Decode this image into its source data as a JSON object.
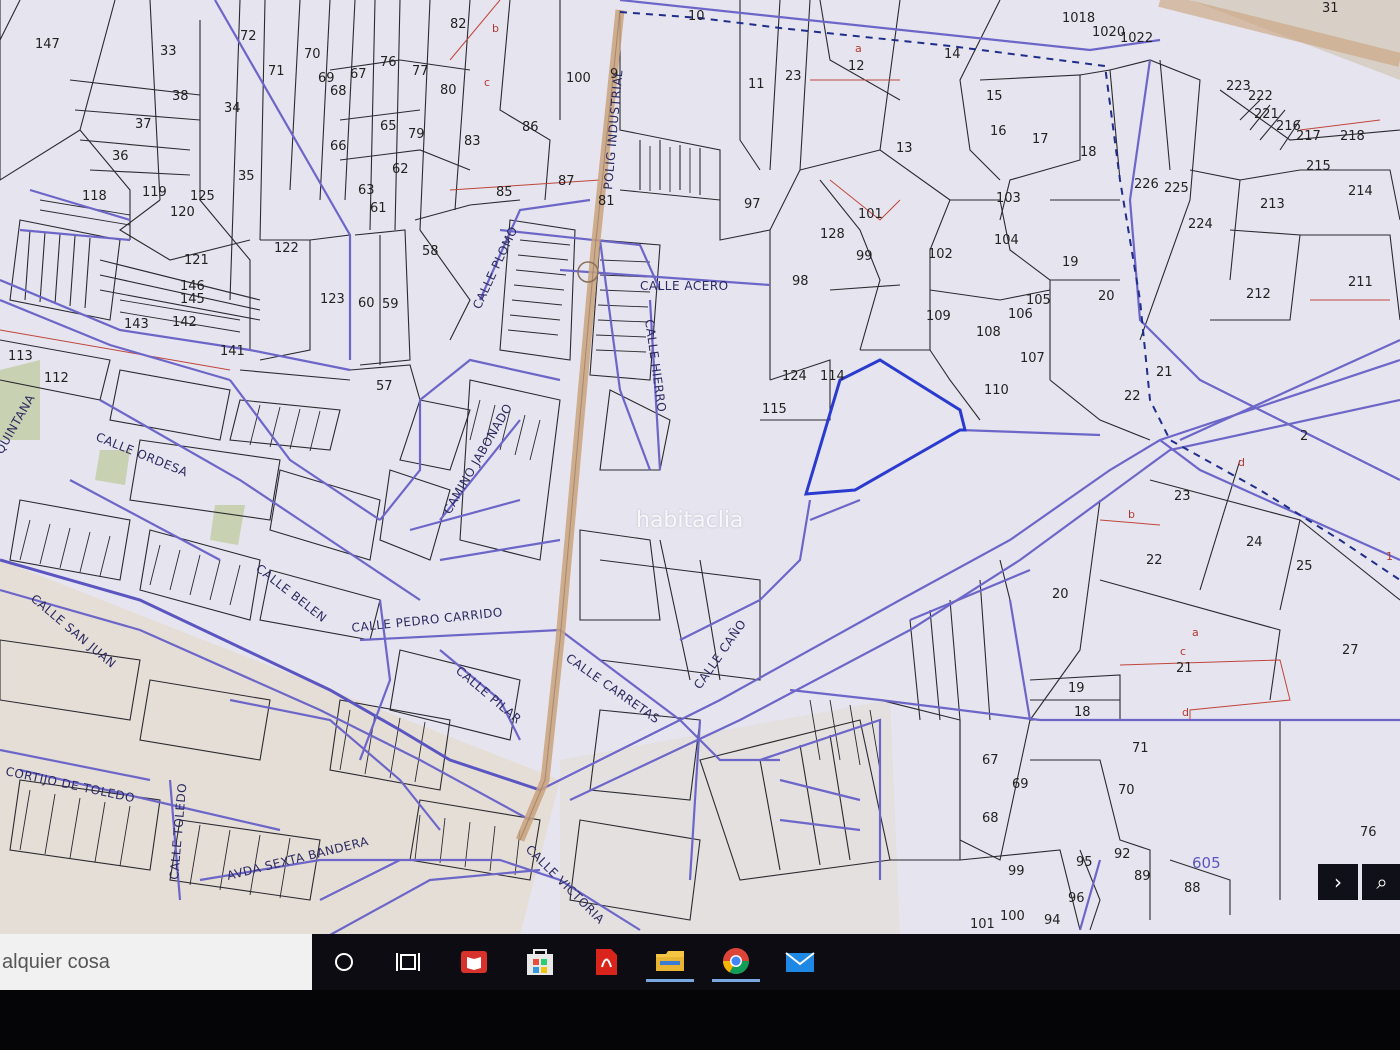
{
  "map": {
    "watermark": "habitaclia",
    "streets": [
      {
        "id": "polig-industrial",
        "label": "POLIG INDUSTRIAL"
      },
      {
        "id": "calle-acero",
        "label": "CALLE ACERO"
      },
      {
        "id": "calle-hierro",
        "label": "CALLE HIERRO"
      },
      {
        "id": "calle-plomo",
        "label": "CALLE PLOMO"
      },
      {
        "id": "calle-dorada",
        "label": "CALLE ORDESA"
      },
      {
        "id": "calle-belen",
        "label": "CALLE BELEN"
      },
      {
        "id": "calle-pedro-carrido",
        "label": "CALLE PEDRO CARRIDO"
      },
      {
        "id": "calle-carretas",
        "label": "CALLE CARRETAS"
      },
      {
        "id": "calle-cano",
        "label": "CALLE CAÑO"
      },
      {
        "id": "calle-pilar",
        "label": "CALLE PILAR"
      },
      {
        "id": "calle-san-juan",
        "label": "CALLE SAN JUAN"
      },
      {
        "id": "cortijo-de-toledo",
        "label": "CORTIJO DE TOLEDO"
      },
      {
        "id": "calle-toledo",
        "label": "CALLE TOLEDO"
      },
      {
        "id": "avda-sexta-bandera",
        "label": "AVDA SEXTA BANDERA"
      },
      {
        "id": "calle-victoria",
        "label": "CALLE VICTORIA"
      },
      {
        "id": "camino-jabonado",
        "label": "CAMINO JABONADO"
      },
      {
        "id": "calle-quintana",
        "label": "QUINTANA"
      }
    ],
    "parcel_labels": [
      "147",
      "33",
      "72",
      "71",
      "70",
      "69",
      "68",
      "67",
      "76",
      "77",
      "80",
      "82",
      "100",
      "9",
      "10",
      "11",
      "23",
      "12",
      "14",
      "15",
      "16",
      "17",
      "18",
      "1018",
      "1020",
      "1022",
      "31",
      "223",
      "222",
      "221",
      "217",
      "216",
      "218",
      "215",
      "214",
      "213",
      "212",
      "211",
      "38",
      "37",
      "36",
      "34",
      "35",
      "65",
      "66",
      "79",
      "62",
      "61",
      "63",
      "83",
      "86",
      "85",
      "87",
      "81",
      "97",
      "13",
      "101",
      "103",
      "104",
      "105",
      "106",
      "107",
      "226",
      "225",
      "224",
      "19",
      "20",
      "21",
      "22",
      "118",
      "119",
      "120",
      "125",
      "121",
      "146",
      "145",
      "143",
      "142",
      "141",
      "122",
      "58",
      "123",
      "60",
      "59",
      "57",
      "113",
      "112",
      "98",
      "128",
      "99",
      "102",
      "109",
      "108",
      "110",
      "124",
      "114",
      "115",
      "2",
      "23",
      "24",
      "25",
      "22",
      "20",
      "21",
      "27",
      "19",
      "18",
      "71",
      "70",
      "67",
      "69",
      "68",
      "99",
      "95",
      "92",
      "89",
      "88",
      "96",
      "94",
      "100",
      "101",
      "76",
      "a",
      "b",
      "c",
      "d",
      "1"
    ],
    "red_labels": [
      "a",
      "b",
      "c",
      "d"
    ],
    "boundary_label": "605",
    "controls": {
      "next": "›",
      "search": "⌕"
    }
  },
  "taskbar": {
    "search_text": "alquier cosa",
    "icons": [
      {
        "name": "cortana-icon",
        "glyph": "○"
      },
      {
        "name": "task-view-icon",
        "glyph": "⧉"
      },
      {
        "name": "reader-icon",
        "glyph": "▣"
      },
      {
        "name": "store-icon",
        "glyph": "▦"
      },
      {
        "name": "pdf-icon",
        "glyph": "▲"
      },
      {
        "name": "file-explorer-icon",
        "glyph": "▭"
      },
      {
        "name": "chrome-icon",
        "glyph": "◉"
      },
      {
        "name": "mail-icon",
        "glyph": "✉"
      }
    ]
  }
}
